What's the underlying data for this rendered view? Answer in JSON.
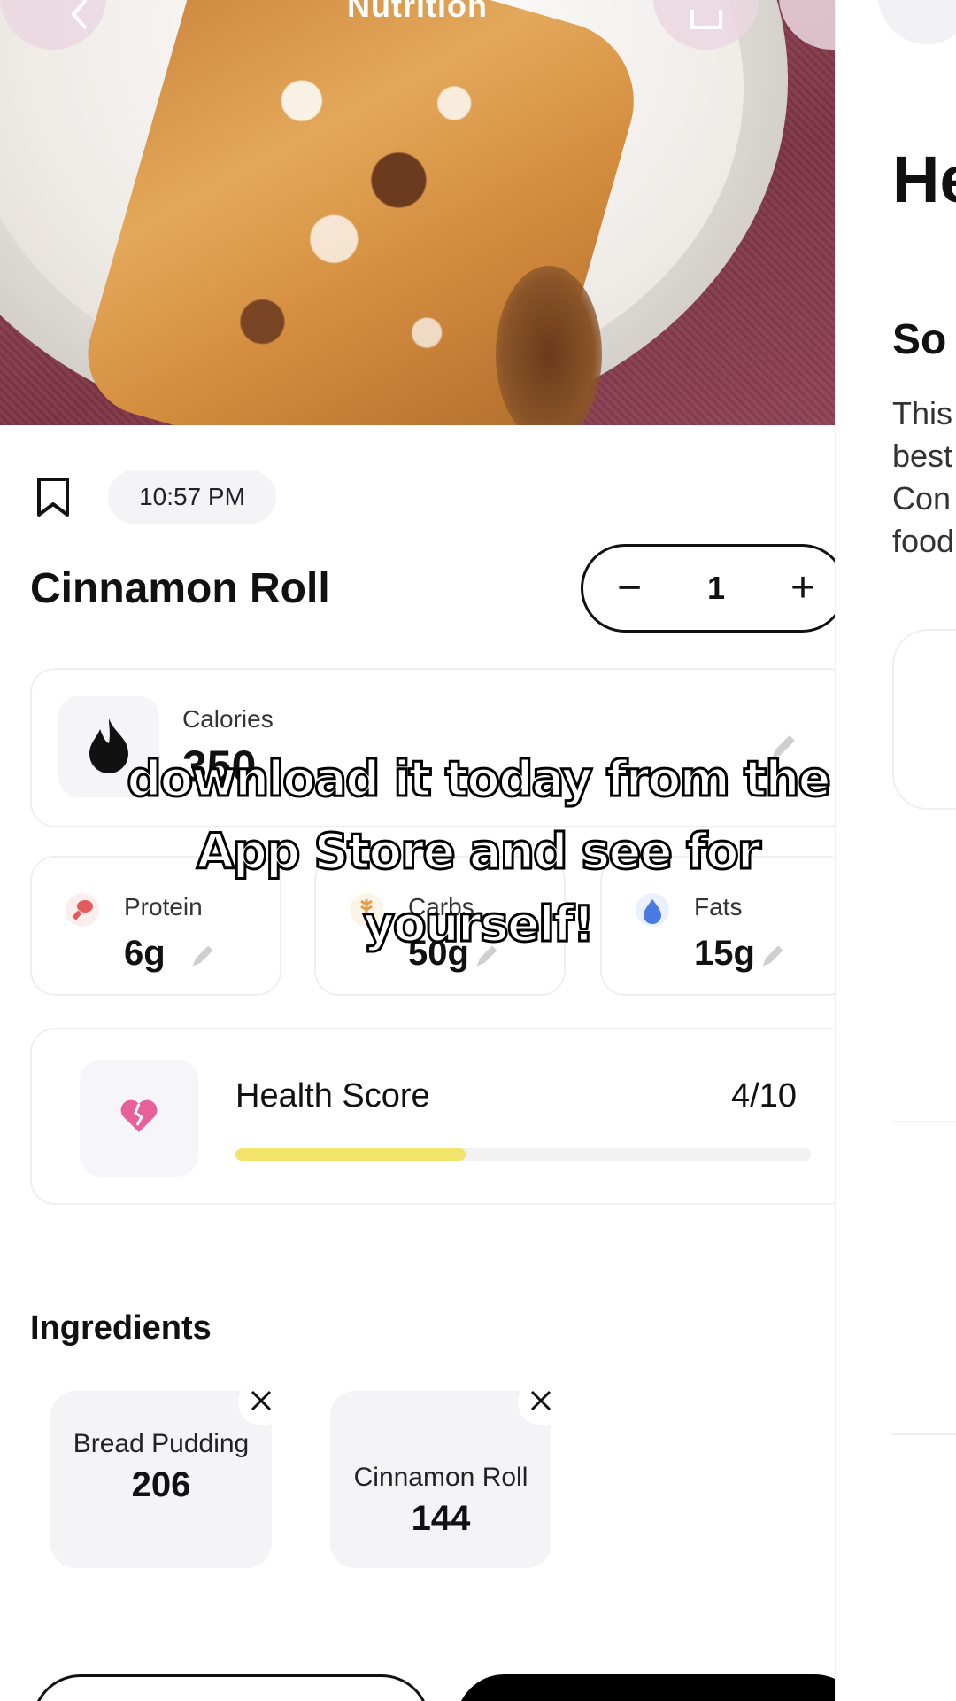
{
  "header": {
    "title": "Nutrition",
    "back_icon": "chevron-left-icon",
    "share_icon": "share-icon",
    "more_icon": "more-icon"
  },
  "entry": {
    "time": "10:57 PM",
    "name": "Cinnamon Roll",
    "quantity": "1",
    "decrement_label": "−",
    "increment_label": "+"
  },
  "calories": {
    "label": "Calories",
    "value": "350"
  },
  "macros": [
    {
      "label": "Protein",
      "value": "6g",
      "icon": "drumstick-icon",
      "color": "#e45b5b"
    },
    {
      "label": "Carbs",
      "value": "50g",
      "icon": "wheat-icon",
      "color": "#e0a050"
    },
    {
      "label": "Fats",
      "value": "15g",
      "icon": "droplet-icon",
      "color": "#4a7be0"
    }
  ],
  "health": {
    "label": "Health Score",
    "score": "4/10",
    "fraction": 0.4,
    "icon": "broken-heart-icon",
    "bar_color": "#f2e36a",
    "icon_color": "#e8609a"
  },
  "ingredients": {
    "title": "Ingredients",
    "items": [
      {
        "name": "Bread Pudding",
        "value": "206"
      },
      {
        "name": "Cinnamon Roll",
        "value": "144"
      }
    ]
  },
  "side_panel": {
    "heading": "He",
    "subheading": "So",
    "lines": [
      "This",
      "best",
      "Con",
      "food"
    ]
  },
  "caption": {
    "line1": "download it today from the",
    "line2": "App Store and see for",
    "line3": "yourself!"
  }
}
